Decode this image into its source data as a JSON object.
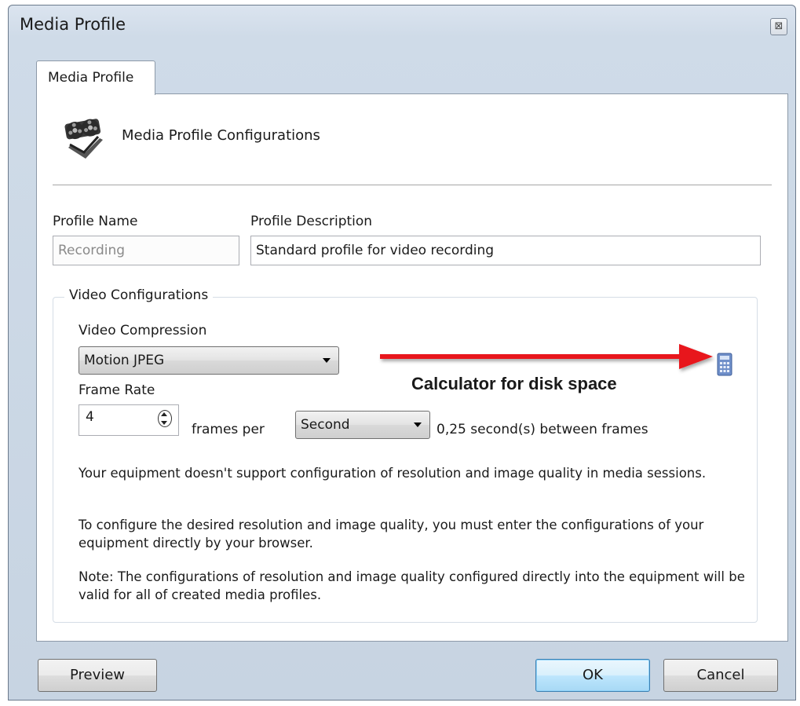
{
  "window": {
    "title": "Media Profile",
    "close_glyph": "⊠"
  },
  "tab": {
    "label": "Media Profile"
  },
  "header": {
    "icon": "film-reel-icon",
    "text": "Media Profile Configurations"
  },
  "profile": {
    "name_label": "Profile Name",
    "name_value": "Recording",
    "description_label": "Profile Description",
    "description_value": "Standard profile for video recording"
  },
  "video": {
    "group_title": "Video Configurations",
    "compression_label": "Video Compression",
    "compression_value": "Motion JPEG",
    "frame_rate_label": "Frame Rate",
    "frame_rate_value": "4",
    "frames_per_label": "frames per",
    "period_value": "Second",
    "between_frames_text": "0,25 second(s) between frames",
    "calculator_icon": "calculator-icon"
  },
  "annotation": {
    "text": "Calculator for disk space",
    "arrow_color": "#e8141b"
  },
  "notes": {
    "p1": "Your equipment doesn't support configuration of resolution and image quality in media sessions.",
    "p2": "To configure the desired resolution and image quality, you must enter the configurations of your equipment directly by your browser.",
    "p3": "Note: The configurations of resolution and image quality configured directly into the equipment will be valid for all of created media profiles."
  },
  "buttons": {
    "preview": "Preview",
    "ok": "OK",
    "cancel": "Cancel"
  }
}
